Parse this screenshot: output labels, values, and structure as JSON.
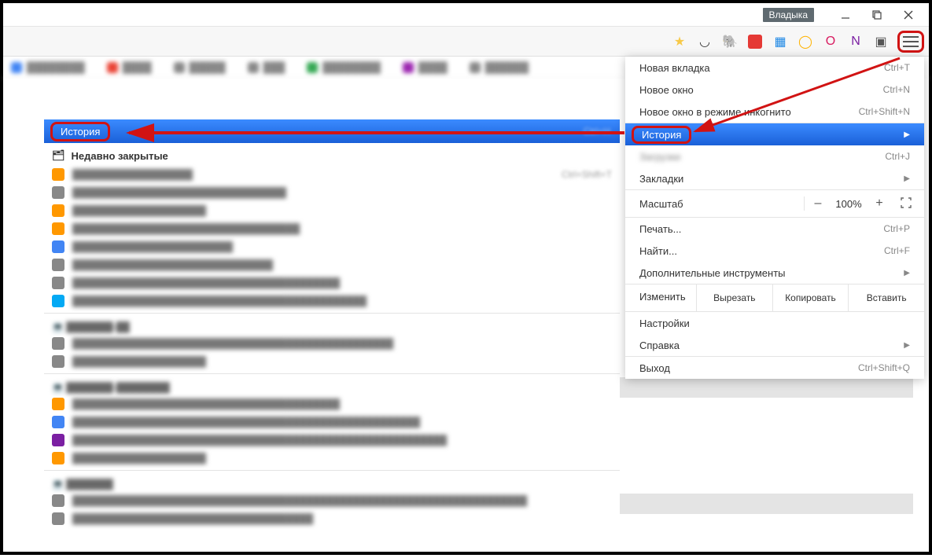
{
  "window": {
    "profile_label": "Владыка"
  },
  "bookmarks": [
    {
      "color": "#4285f4"
    },
    {
      "color": "#ea4335"
    },
    {
      "color": "#888"
    },
    {
      "color": "#888"
    },
    {
      "color": "#34a853"
    },
    {
      "color": "#888"
    },
    {
      "color": "#9c27b0"
    },
    {
      "color": "#888"
    }
  ],
  "main_menu": {
    "new_tab": {
      "label": "Новая вкладка",
      "shortcut": "Ctrl+T"
    },
    "new_window": {
      "label": "Новое окно",
      "shortcut": "Ctrl+N"
    },
    "incognito": {
      "label": "Новое окно в режиме инкогнито",
      "shortcut": "Ctrl+Shift+N"
    },
    "history": {
      "label": "История"
    },
    "downloads": {
      "label": "Загрузки",
      "shortcut": "Ctrl+J"
    },
    "bookmarks": {
      "label": "Закладки"
    },
    "zoom": {
      "label": "Масштаб",
      "minus": "–",
      "pct": "100%",
      "plus": "+"
    },
    "print": {
      "label": "Печать...",
      "shortcut": "Ctrl+P"
    },
    "find": {
      "label": "Найти...",
      "shortcut": "Ctrl+F"
    },
    "more_tools": {
      "label": "Дополнительные инструменты"
    },
    "edit": {
      "label": "Изменить",
      "cut": "Вырезать",
      "copy": "Копировать",
      "paste": "Вставить"
    },
    "settings": {
      "label": "Настройки"
    },
    "help": {
      "label": "Справка"
    },
    "exit": {
      "label": "Выход",
      "shortcut": "Ctrl+Shift+Q"
    }
  },
  "history_popup": {
    "header_label": "История",
    "header_shortcut": "Ctrl+H",
    "recently_closed": "Недавно закрытые",
    "reopen_shortcut": "Ctrl+Shift+T",
    "items": [
      {
        "color": "#ff9800"
      },
      {
        "color": "#888"
      },
      {
        "color": "#ff9800"
      },
      {
        "color": "#ff9800"
      },
      {
        "color": "#4285f4"
      },
      {
        "color": "#888"
      },
      {
        "color": "#888"
      },
      {
        "color": "#03a9f4"
      }
    ],
    "device1_items": [
      {
        "color": "#888"
      },
      {
        "color": "#888"
      }
    ],
    "device2_items": [
      {
        "color": "#ff9800"
      },
      {
        "color": "#4285f4"
      },
      {
        "color": "#7b1fa2"
      },
      {
        "color": "#ff9800"
      }
    ],
    "device3_items": [
      {
        "color": "#888"
      },
      {
        "color": "#888"
      }
    ]
  }
}
